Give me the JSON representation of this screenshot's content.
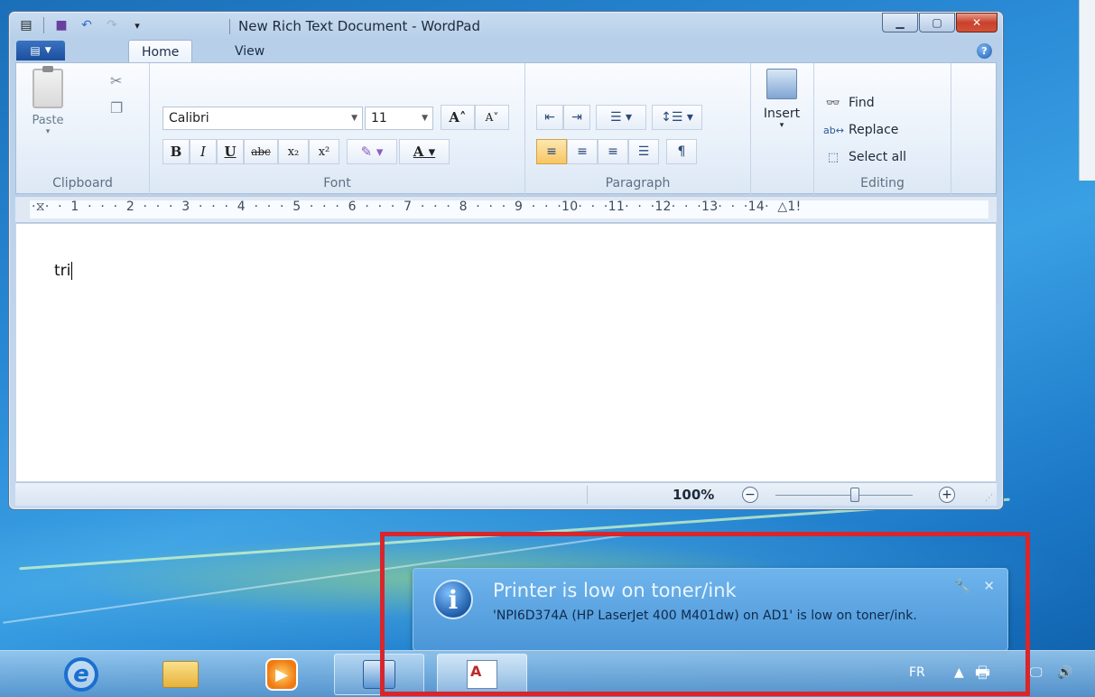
{
  "window": {
    "title": "New Rich Text Document - WordPad"
  },
  "ribbon": {
    "tabs": [
      "Home",
      "View"
    ],
    "clipboard": {
      "paste": "Paste",
      "label": "Clipboard"
    },
    "font": {
      "family": "Calibri",
      "size": "11",
      "label": "Font",
      "bold": "B",
      "italic": "I",
      "underline": "U",
      "strike": "abc",
      "subscript": "x₂",
      "superscript": "x²"
    },
    "paragraph": {
      "label": "Paragraph"
    },
    "insert": {
      "label": "Insert"
    },
    "editing": {
      "find": "Find",
      "replace": "Replace",
      "select_all": "Select all",
      "label": "Editing"
    }
  },
  "ruler": {
    "marks": "·⧖·  ·  1  ·  ·  ·  2  ·  ·  ·  3  ·  ·  ·  4  ·  ·  ·  5  ·  ·  ·  6  ·  ·  ·  7  ·  ·  ·  8  ·  ·  ·  9  ·  ·  ·10·  ·  ·11·  ·  ·12·  ·  ·13·  ·  ·14·  △1!"
  },
  "document": {
    "text": "tri"
  },
  "status": {
    "zoom": "100%",
    "zoom_level": 0.58
  },
  "notification": {
    "title": "Printer is low on toner/ink",
    "body": "'NPI6D374A (HP LaserJet 400 M401dw) on AD1' is low on toner/ink."
  },
  "taskbar": {
    "language": "FR"
  },
  "colors": {
    "highlight": "#d7262c",
    "balloon": "#4b96d8"
  }
}
